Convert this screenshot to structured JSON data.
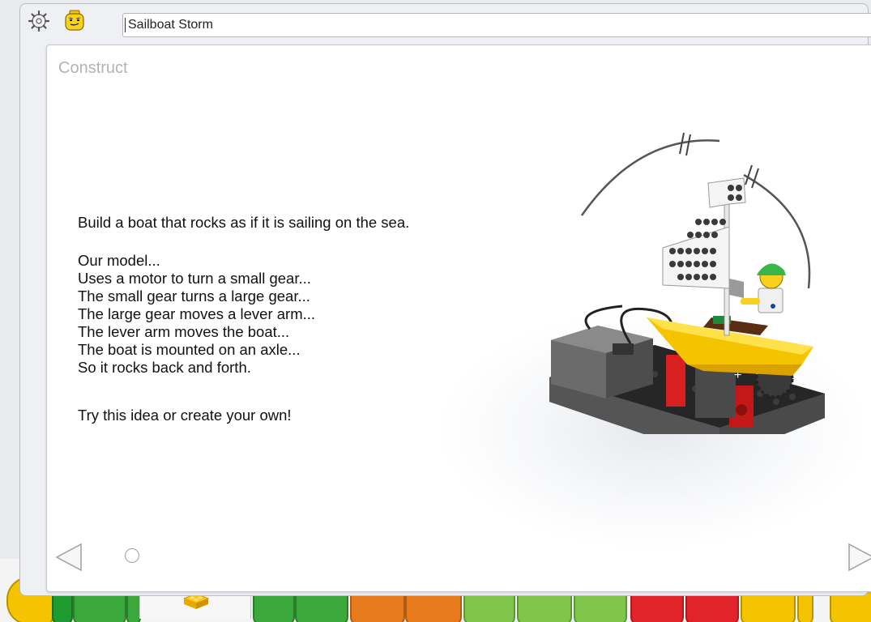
{
  "window": {
    "title": "Sailboat Storm",
    "icons": [
      "gear-icon",
      "lego-head-icon"
    ]
  },
  "page": {
    "heading": "Construct",
    "intro": "Build a boat that rocks as if it is sailing on the sea.",
    "model_lines": [
      "Our model...",
      "Uses a motor to turn a small gear...",
      "The small gear turns a large gear...",
      "The large gear moves a lever arm...",
      "The lever arm moves the boat...",
      "The boat is mounted on an axle...",
      "So it rocks back and forth."
    ],
    "closing": "Try this idea or create your own!"
  },
  "navigation": {
    "prev_icon": "triangle-left-icon",
    "next_icon": "triangle-right-icon",
    "page_indicator_count": 1
  },
  "palette": {
    "active_tab_icon": "lego-brick-icon",
    "block_colors": [
      "#f4c400",
      "#3aa83a",
      "#3aa83a",
      "#e87a1e",
      "#e87a1e",
      "#7fc64a",
      "#7fc64a",
      "#7fc64a",
      "#e0242a",
      "#e0242a",
      "#f4c400",
      "#f4c400"
    ]
  },
  "colors": {
    "window_bg": "#eef0f3",
    "panel_bg": "#ffffff",
    "heading": "#b0b3b8",
    "text": "#111111"
  }
}
